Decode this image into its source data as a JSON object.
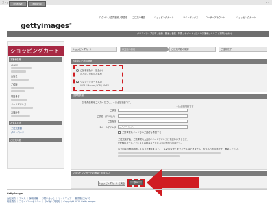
{
  "topbar": {
    "title": "ストックフォトのゲッティイメージズ",
    "right_dots": "・・・"
  },
  "util_nav": {
    "items": [
      "ログイン / 会員登録 / 英語版",
      "ご注文の確認",
      "ショッピングカート",
      "ライトボックス",
      "ユーザーアカウント",
      "ショッピングカート"
    ]
  },
  "logo": {
    "text": "gettyimages",
    "mark": "®"
  },
  "navbar": {
    "items": [
      "creative",
      "editorial"
    ],
    "subnav": "クリエイティブ素材 / 画像 / 動画 / 音楽 / 特集 / サポート / 法人のお客様 / ヘルプ / お問い合わせ"
  },
  "sidebar": {
    "title": "ショッピングカート",
    "sections": [
      "お客様情報",
      "お支払方法",
      "ご注文内容"
    ],
    "fields": [
      "お名前",
      "会社名",
      "ご住所",
      "電話番号",
      "メールアドレス",
      "お届け先"
    ],
    "links": [
      "ご注文履歴",
      "ダウンロード"
    ]
  },
  "steps": [
    "ショッピングカート",
    "お支払い方法",
    "ご注文内容の確認",
    "ご注文完了"
  ],
  "payment": {
    "header": "お支払い方法の選択",
    "option1": "ご請求書払い（後払い）",
    "option1_note": "法人のご契約のお客様",
    "option2": "クレジットカード払い",
    "option2_note": "VISA / Master / JCB / AMEX"
  },
  "address": {
    "header": "請求先情報",
    "intro": "請求先情報をご入力ください。＊は必須項目です。",
    "required_note": "＊は必須項目です",
    "fields": [
      {
        "label": "ご氏名",
        "value": ""
      },
      {
        "label": "ご氏名（フリガナ）",
        "value": ""
      },
      {
        "label": "ご会社名",
        "value": ""
      },
      {
        "label": "Eメールアドレス",
        "value": "ご入力ください"
      }
    ],
    "checkbox": "ご請求書をメールでのご送付を希望する",
    "note1": "ご注文完了後、ご請求書を上記のEメールアドレスにお送りいたします。",
    "note2": "※登録のメールアドレスとは異なるアドレスへの送付も可能です。",
    "note3": "注文内容の確認画面にて注文を確定すると、ご注文の変更・キャンセルはできません。お支払方法の選択をご確認ください。"
  },
  "buttons": {
    "header": "ショッピングカートの確認・お支払い",
    "back": "ショッピングカートに戻る",
    "next": "次へ"
  },
  "footer": {
    "heading": "Getty Images",
    "links1": "会社案内 ｜ プレス ｜ 採用情報 ｜ お問い合わせ ｜ サイトマップ ｜ 著作権について",
    "links2": "利用規約 ｜ プライバシーポリシー ｜ ライセンス契約 ｜ Copyright 2011 Getty Images"
  },
  "colors": {
    "accent": "#a72843",
    "annotation": "#d01c22",
    "nav": "#6e6e6e"
  }
}
